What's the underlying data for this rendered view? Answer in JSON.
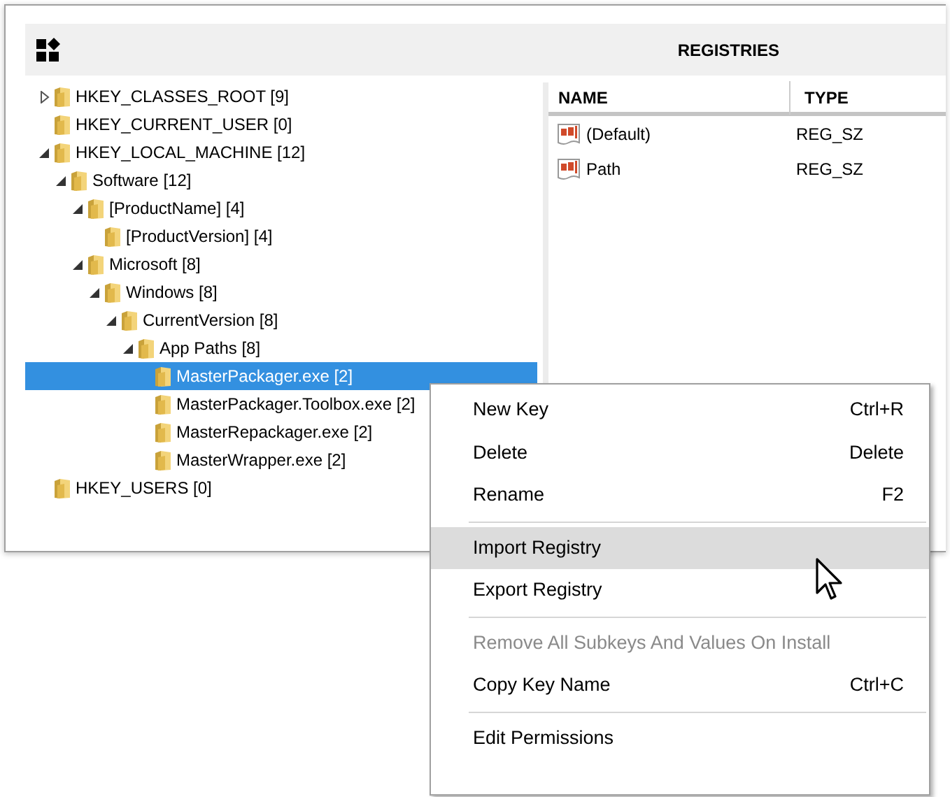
{
  "header": {
    "title": "REGISTRIES"
  },
  "tree": [
    {
      "label": "HKEY_CLASSES_ROOT [9]",
      "expanded": false,
      "selected": false
    },
    {
      "label": "HKEY_CURRENT_USER [0]",
      "selected": false
    },
    {
      "label": "HKEY_LOCAL_MACHINE [12]",
      "expanded": true,
      "selected": false,
      "children": [
        {
          "label": "Software [12]",
          "expanded": true,
          "selected": false,
          "children": [
            {
              "label": "[ProductName] [4]",
              "expanded": true,
              "selected": false,
              "children": [
                {
                  "label": "[ProductVersion] [4]",
                  "selected": false
                }
              ]
            },
            {
              "label": "Microsoft [8]",
              "expanded": true,
              "selected": false,
              "children": [
                {
                  "label": "Windows [8]",
                  "expanded": true,
                  "selected": false,
                  "children": [
                    {
                      "label": "CurrentVersion [8]",
                      "expanded": true,
                      "selected": false,
                      "children": [
                        {
                          "label": "App Paths [8]",
                          "expanded": true,
                          "selected": false,
                          "children": [
                            {
                              "label": "MasterPackager.exe [2]",
                              "selected": true
                            },
                            {
                              "label": "MasterPackager.Toolbox.exe [2]",
                              "selected": false
                            },
                            {
                              "label": "MasterRepackager.exe [2]",
                              "selected": false
                            },
                            {
                              "label": "MasterWrapper.exe [2]",
                              "selected": false
                            }
                          ]
                        }
                      ]
                    }
                  ]
                }
              ]
            }
          ]
        }
      ]
    },
    {
      "label": "HKEY_USERS [0]",
      "selected": false
    }
  ],
  "values_table": {
    "columns": [
      "NAME",
      "TYPE"
    ],
    "rows": [
      {
        "name": "(Default)",
        "type": "REG_SZ"
      },
      {
        "name": "Path",
        "type": "REG_SZ"
      }
    ]
  },
  "context_menu": [
    {
      "kind": "item",
      "label": "New Key",
      "shortcut": "Ctrl+R",
      "highlighted": false,
      "disabled": false
    },
    {
      "kind": "item",
      "label": "Delete",
      "shortcut": "Delete",
      "highlighted": false,
      "disabled": false
    },
    {
      "kind": "item",
      "label": "Rename",
      "shortcut": "F2",
      "highlighted": false,
      "disabled": false
    },
    {
      "kind": "separator"
    },
    {
      "kind": "item",
      "label": "Import Registry",
      "highlighted": true,
      "disabled": false
    },
    {
      "kind": "item",
      "label": "Export Registry",
      "highlighted": false,
      "disabled": false
    },
    {
      "kind": "separator"
    },
    {
      "kind": "item",
      "label": "Remove All Subkeys And Values On Install",
      "highlighted": false,
      "disabled": true
    },
    {
      "kind": "item",
      "label": "Copy Key Name",
      "shortcut": "Ctrl+C",
      "highlighted": false,
      "disabled": false
    },
    {
      "kind": "separator"
    },
    {
      "kind": "item",
      "label": "Edit Permissions",
      "highlighted": false,
      "disabled": false
    }
  ]
}
